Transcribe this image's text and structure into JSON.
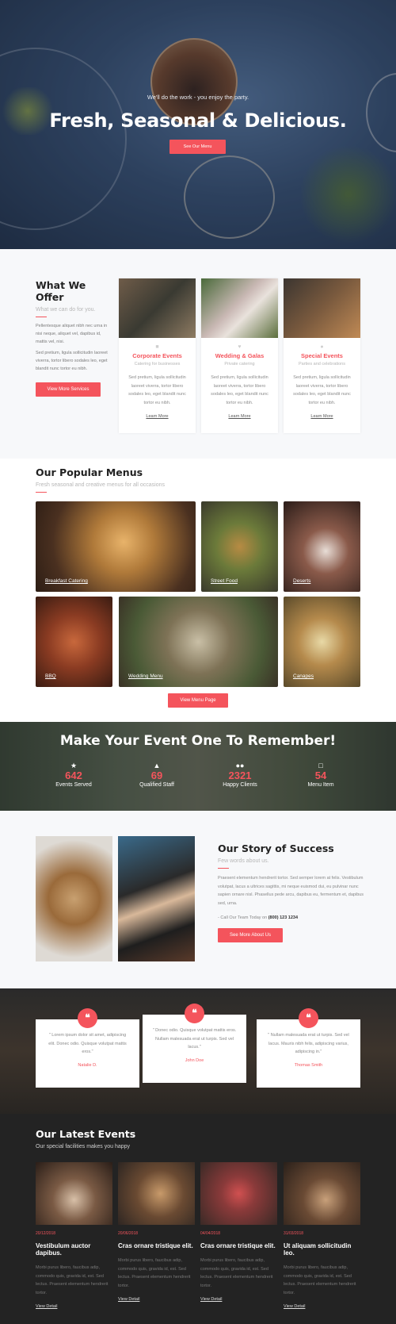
{
  "colors": {
    "accent": "#f4545c",
    "dark": "#232323",
    "light_bg": "#f7f8fa"
  },
  "hero": {
    "tagline": "We'll do the work - you enjoy the party.",
    "title": "Fresh, Seasonal & Delicious.",
    "button": "See Our Menu"
  },
  "offer": {
    "title": "What We Offer",
    "subtitle": "What we can do for you.",
    "para1": "Pellentesque aliquet nibh nec urna in nisi neque, aliquet vel, dapibus id, mattis vel, nisi.",
    "para2": "Sed pretium, ligula sollicitudin laoreet viverra, tortor libero sodales leo, eget blandit nunc tortor eu nibh.",
    "button": "View More Services",
    "cards": [
      {
        "icon": "contact-card-icon",
        "title": "Corporate Events",
        "subtitle": "Catering for businesses",
        "desc": "Sed pretium, ligula sollicitudin laoreet viverra, tortor libero sodales leo, eget blandit nunc tortor eu nibh.",
        "link": "Learn More"
      },
      {
        "icon": "heart-icon",
        "title": "Wedding & Galas",
        "subtitle": "Private catering",
        "desc": "Sed pretium, ligula sollicitudin laoreet viverra, tortor libero sodales leo, eget blandit nunc tortor eu nibh.",
        "link": "Learn More"
      },
      {
        "icon": "user-icon",
        "title": "Special Events",
        "subtitle": "Parties and celebrations",
        "desc": "Sed pretium, ligula sollicitudin laoreet viverra, tortor libero sodales leo, eget blandit nunc tortor eu nibh.",
        "link": "Learn More"
      }
    ]
  },
  "menus": {
    "title": "Our Popular Menus",
    "subtitle": "Fresh seasonal and creative menus for all occasions",
    "items": [
      "Breakfast Catering",
      "Street Food",
      "Deserts",
      "BBQ",
      "Wedding Menu",
      "Canapes"
    ],
    "button": "View Menu Page"
  },
  "stats": {
    "title": "Make Your Event One To Remember!",
    "items": [
      {
        "icon": "cutlery-icon",
        "value": "642",
        "label": "Events Served"
      },
      {
        "icon": "thumbs-up-icon",
        "value": "69",
        "label": "Qualified Staff"
      },
      {
        "icon": "users-icon",
        "value": "2321",
        "label": "Happy Clients"
      },
      {
        "icon": "document-icon",
        "value": "54",
        "label": "Menu Item"
      }
    ]
  },
  "story": {
    "title": "Our Story of Success",
    "subtitle": "Few words about us.",
    "para": "Praesent elementum hendrerit tortor. Sed semper lorem at felis. Vestibulum volutpat, lacus a ultrices sagittis, mi neque euismod dui, eu pulvinar nunc sapien ornare nisl. Phasellus pede arcu, dapibus eu, fermentum et, dapibus sed, urna.",
    "call_prefix": "- Call Our Team Today on",
    "phone": "(800) 123 1234",
    "button": "See More About Us"
  },
  "testimonials": [
    {
      "quote": "\" Lorem ipsum dolor sit amet, adipiscing elit. Donec odio. Quisque volutpat mattis eros.\"",
      "author": "Natalie D."
    },
    {
      "quote": "\" Donec odio. Quisque volutpat mattis eros. Nullam malesuada erat ut turpis. Sed vel lacus.\"",
      "author": "John Doe"
    },
    {
      "quote": "\" Nullam malesuada erat ut turpis. Sed vel lacus. Mauris nibh felis, adipiscing varius, adipiscing in.\"",
      "author": "Thomas Smith"
    }
  ],
  "events": {
    "title": "Our Latest Events",
    "subtitle": "Our special facilities makes you happy",
    "items": [
      {
        "date": "20/12/2018",
        "title": "Vestibulum auctor dapibus.",
        "desc": "Morbi purus libero, faucibus adip, commodo quis, gravida id, est. Sed lectus. Praesent elementum hendrerit tortor.",
        "link": "View Detail"
      },
      {
        "date": "20/06/2018",
        "title": "Cras ornare tristique elit.",
        "desc": "Morbi purus libero, faucibus adip, commodo quis, gravida id, est. Sed lectus. Praesent elementum hendrerit tortor.",
        "link": "View Detail"
      },
      {
        "date": "04/04/2018",
        "title": "Cras ornare tristique elit.",
        "desc": "Morbi purus libero, faucibus adip, commodo quis, gravida id, est. Sed lectus. Praesent elementum hendrerit tortor.",
        "link": "View Detail"
      },
      {
        "date": "31/03/2018",
        "title": "Ut aliquam sollicitudin leo.",
        "desc": "Morbi purus libero, faucibus adip, commodo quis, gravida id, est. Sed lectus. Praesent elementum hendrerit tortor.",
        "link": "View Detail"
      }
    ]
  }
}
